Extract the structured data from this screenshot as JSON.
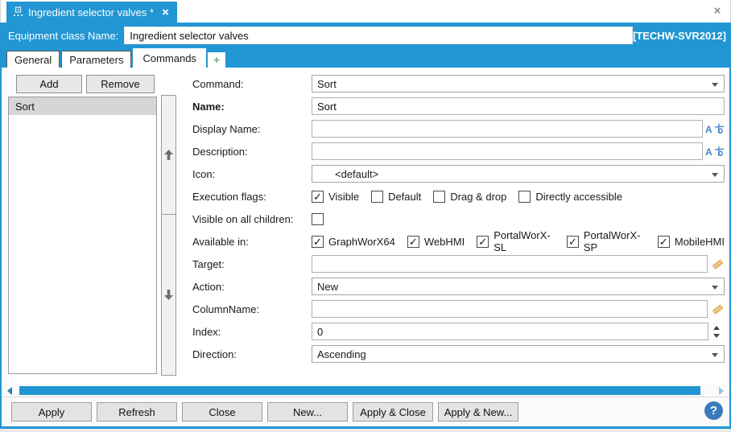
{
  "window": {
    "close_label": "×"
  },
  "doc_tab": {
    "title": "Ingredient selector valves *",
    "close_label": "×"
  },
  "header": {
    "label": "Equipment class Name:",
    "value": "Ingredient selector valves",
    "server": "[TECHW-SVR2012]"
  },
  "tabs": {
    "general": "General",
    "parameters": "Parameters",
    "commands": "Commands",
    "add_tab": "+"
  },
  "list_panel": {
    "add_label": "Add",
    "remove_label": "Remove",
    "items": [
      {
        "label": "Sort",
        "selected": true
      }
    ]
  },
  "form": {
    "command": {
      "label": "Command:",
      "value": "Sort"
    },
    "name": {
      "label": "Name:",
      "value": "Sort"
    },
    "display_name": {
      "label": "Display Name:",
      "value": ""
    },
    "description": {
      "label": "Description:",
      "value": ""
    },
    "icon": {
      "label": "Icon:",
      "value": "<default>"
    },
    "execution_flags": {
      "label": "Execution flags:",
      "options": [
        {
          "label": "Visible",
          "checked": true
        },
        {
          "label": "Default",
          "checked": false
        },
        {
          "label": "Drag & drop",
          "checked": false
        },
        {
          "label": "Directly accessible",
          "checked": false
        }
      ]
    },
    "visible_on_all_children": {
      "label": "Visible on all children:",
      "checked": false
    },
    "available_in": {
      "label": "Available in:",
      "options": [
        {
          "label": "GraphWorX64",
          "checked": true
        },
        {
          "label": "WebHMI",
          "checked": true
        },
        {
          "label": "PortalWorX-SL",
          "checked": true
        },
        {
          "label": "PortalWorX-SP",
          "checked": true
        },
        {
          "label": "MobileHMI",
          "checked": true
        }
      ]
    },
    "target": {
      "label": "Target:",
      "value": ""
    },
    "action": {
      "label": "Action:",
      "value": "New"
    },
    "columnname": {
      "label": "ColumnName:",
      "value": ""
    },
    "index": {
      "label": "Index:",
      "value": "0"
    },
    "direction": {
      "label": "Direction:",
      "value": "Ascending"
    }
  },
  "footer": {
    "buttons": [
      "Apply",
      "Refresh",
      "Close",
      "New...",
      "Apply & Close",
      "Apply & New..."
    ],
    "help_label": "?"
  },
  "colors": {
    "accent": "#2196d3",
    "tag_icon": "#e5b86a",
    "help_button": "#3a7abd"
  }
}
